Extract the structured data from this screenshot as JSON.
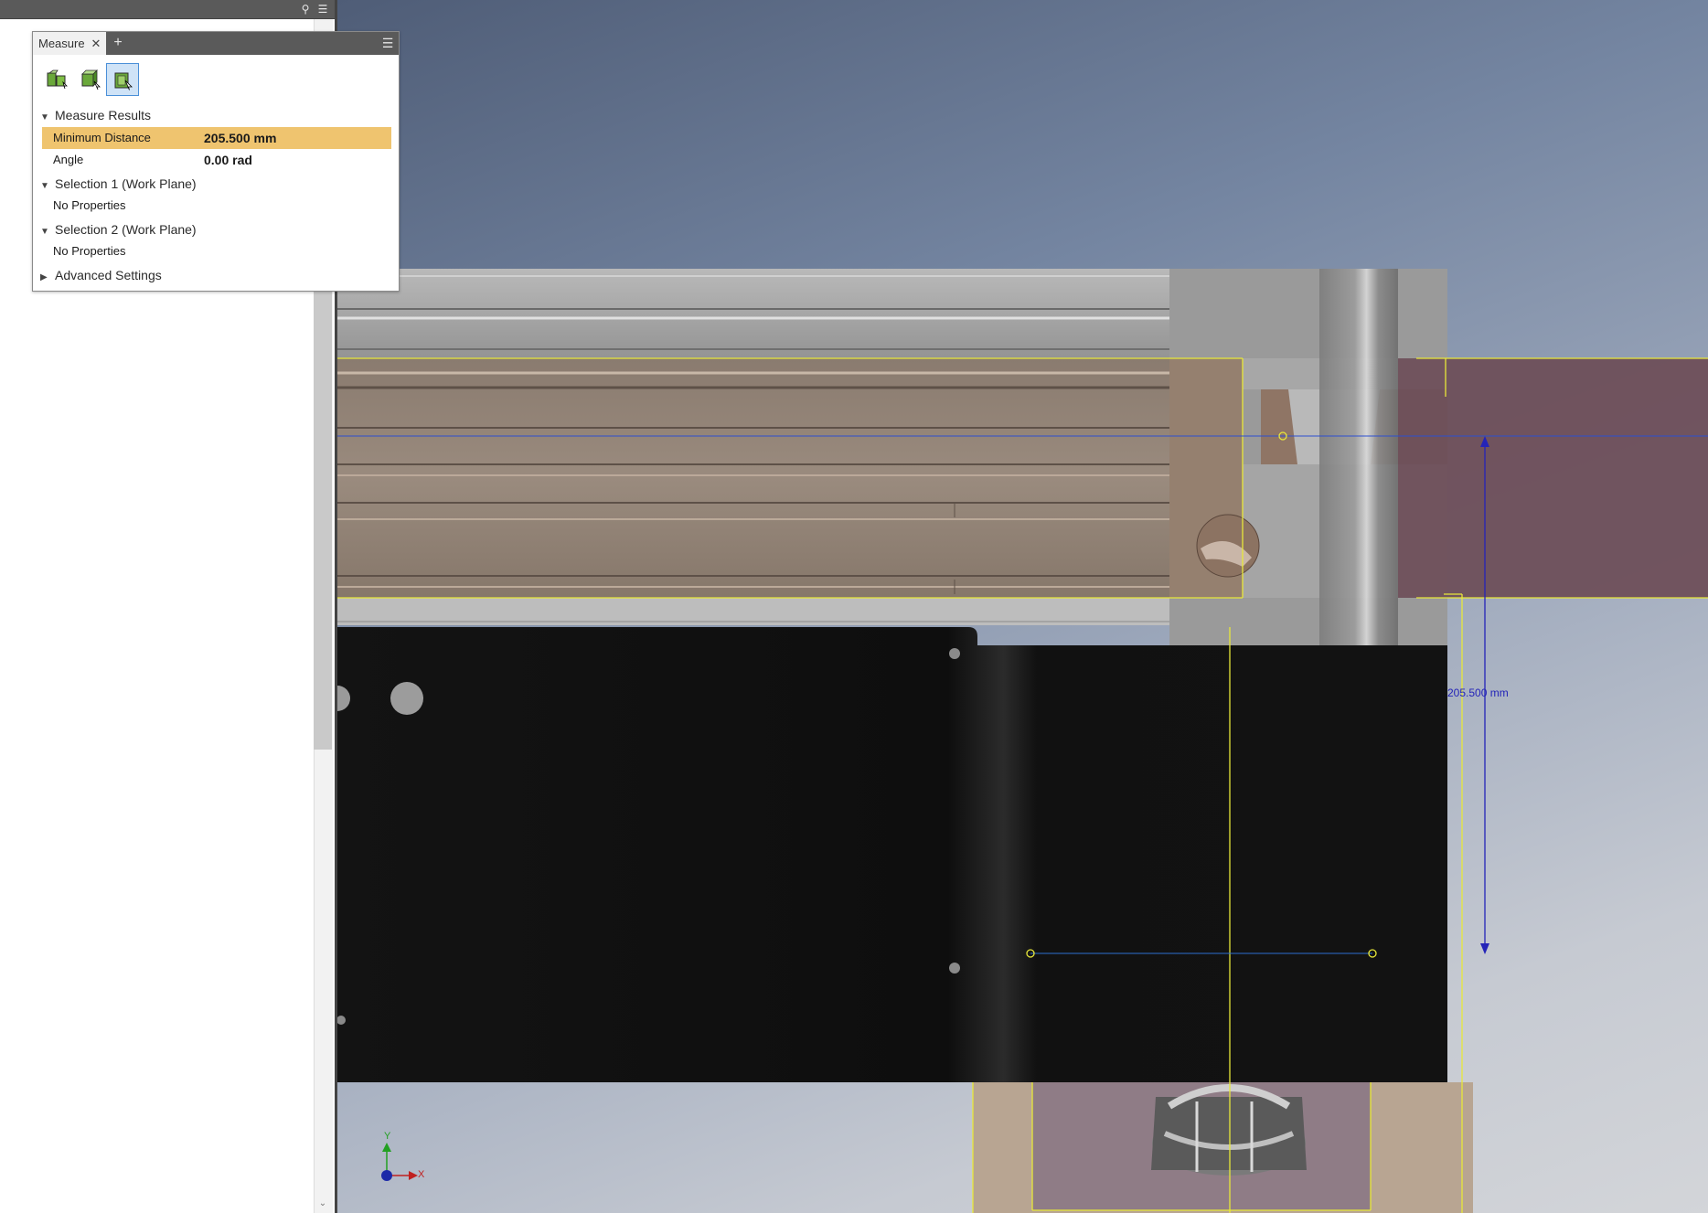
{
  "browser": {
    "search_icon": "search-icon",
    "menu_icon": "hamburger-menu-icon"
  },
  "measure": {
    "tab_label": "Measure",
    "close_glyph": "✕",
    "add_glyph": "+",
    "menu_glyph": "☰",
    "tools": [
      {
        "name": "measure-distance-tool",
        "active": false
      },
      {
        "name": "measure-select-face-tool",
        "active": false
      },
      {
        "name": "measure-select-workplane-tool",
        "active": true
      }
    ],
    "results": {
      "header": "Measure Results",
      "rows": [
        {
          "key": "Minimum Distance",
          "value": "205.500 mm"
        },
        {
          "key": "Angle",
          "value": "0.00 rad"
        }
      ]
    },
    "selection1": {
      "header": "Selection 1 (Work Plane)",
      "body": "No Properties"
    },
    "selection2": {
      "header": "Selection 2 (Work Plane)",
      "body": "No Properties"
    },
    "advanced": {
      "header": "Advanced Settings"
    }
  },
  "viewport": {
    "dimension_label": "205.500 mm",
    "axis_x": "X",
    "axis_y": "Y",
    "colors": {
      "dimension": "#2424b8",
      "highlight": "#efc46f",
      "selection_edge": "#e8e83a"
    }
  }
}
